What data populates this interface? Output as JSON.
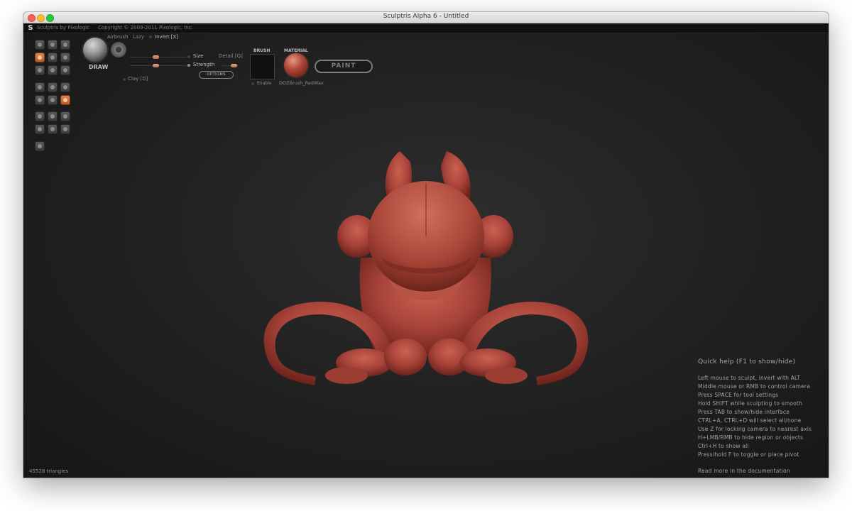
{
  "window": {
    "title": "Sculptris Alpha 6 - Untitled"
  },
  "menubar": {
    "app_name": "Sculptris by Pixologic",
    "copyright": "Copyright © 2009-2011 Pixologic, Inc."
  },
  "toolbar": {
    "brush_name": "DRAW",
    "airbrush_label": "Airbrush",
    "lazy_label": "Lazy",
    "invert_label": "Invert [X]",
    "size_label": "Size",
    "strength_label": "Strength",
    "detail_label": "Detail [Q]",
    "clay_label": "Clay [D]",
    "options_label": "OPTIONS",
    "brush_header": "BRUSH",
    "material_header": "MATERIAL",
    "enable_label": "Enable",
    "material_name": "DOZBrush_RedWax",
    "paint_label": "PAINT",
    "active_tool_color": "#d2703c"
  },
  "tool_palette": {
    "icons": [
      "draw-icon",
      "rotate-icon",
      "crease-icon",
      "flatten-icon",
      "inflate-icon",
      "pinch-icon",
      "grab-icon",
      "smooth-icon",
      "scale-icon",
      "reduce-icon",
      "mask-icon",
      "plane-icon",
      "globe-icon",
      "wave-icon",
      "symmetry-icon",
      "sphere-icon",
      "subdivide-icon",
      "export-icon",
      "minus-icon",
      "import-icon",
      "save-icon",
      "camera-icon"
    ]
  },
  "quick_help": {
    "title": "Quick help (F1 to show/hide)",
    "lines": [
      "Left mouse to sculpt, invert with ALT",
      "Middle mouse or RMB to control camera",
      "Press SPACE for tool settings",
      "Hold SHIFT while sculpting to smooth",
      "Press TAB to show/hide interface",
      "CTRL+A, CTRL+D will select all/none",
      "Use Z for locking camera to nearest axis",
      "H+LMB/RMB to hide region or objects",
      "Ctrl+H to show all",
      "Press/hold F to toggle or place pivot"
    ],
    "footer": "Read more in the documentation"
  },
  "status": {
    "triangles": "45528 triangles"
  },
  "model": {
    "color": "#b0493c",
    "shadow": "#6e2219",
    "highlight": "#d27563"
  }
}
